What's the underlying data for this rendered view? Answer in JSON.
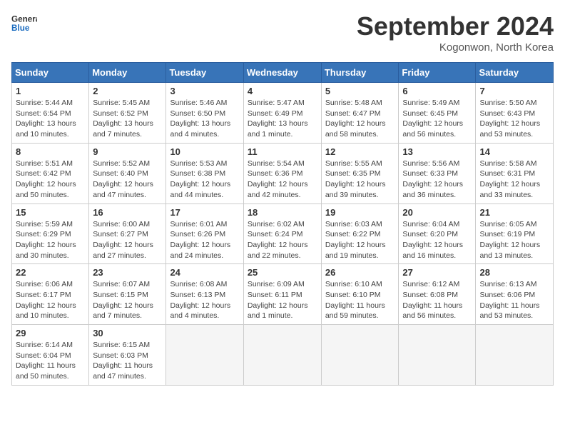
{
  "logo": {
    "line1": "General",
    "line2": "Blue"
  },
  "title": "September 2024",
  "location": "Kogonwon, North Korea",
  "days_of_week": [
    "Sunday",
    "Monday",
    "Tuesday",
    "Wednesday",
    "Thursday",
    "Friday",
    "Saturday"
  ],
  "weeks": [
    [
      {
        "day": 1,
        "info": "Sunrise: 5:44 AM\nSunset: 6:54 PM\nDaylight: 13 hours and 10 minutes."
      },
      {
        "day": 2,
        "info": "Sunrise: 5:45 AM\nSunset: 6:52 PM\nDaylight: 13 hours and 7 minutes."
      },
      {
        "day": 3,
        "info": "Sunrise: 5:46 AM\nSunset: 6:50 PM\nDaylight: 13 hours and 4 minutes."
      },
      {
        "day": 4,
        "info": "Sunrise: 5:47 AM\nSunset: 6:49 PM\nDaylight: 13 hours and 1 minute."
      },
      {
        "day": 5,
        "info": "Sunrise: 5:48 AM\nSunset: 6:47 PM\nDaylight: 12 hours and 58 minutes."
      },
      {
        "day": 6,
        "info": "Sunrise: 5:49 AM\nSunset: 6:45 PM\nDaylight: 12 hours and 56 minutes."
      },
      {
        "day": 7,
        "info": "Sunrise: 5:50 AM\nSunset: 6:43 PM\nDaylight: 12 hours and 53 minutes."
      }
    ],
    [
      {
        "day": 8,
        "info": "Sunrise: 5:51 AM\nSunset: 6:42 PM\nDaylight: 12 hours and 50 minutes."
      },
      {
        "day": 9,
        "info": "Sunrise: 5:52 AM\nSunset: 6:40 PM\nDaylight: 12 hours and 47 minutes."
      },
      {
        "day": 10,
        "info": "Sunrise: 5:53 AM\nSunset: 6:38 PM\nDaylight: 12 hours and 44 minutes."
      },
      {
        "day": 11,
        "info": "Sunrise: 5:54 AM\nSunset: 6:36 PM\nDaylight: 12 hours and 42 minutes."
      },
      {
        "day": 12,
        "info": "Sunrise: 5:55 AM\nSunset: 6:35 PM\nDaylight: 12 hours and 39 minutes."
      },
      {
        "day": 13,
        "info": "Sunrise: 5:56 AM\nSunset: 6:33 PM\nDaylight: 12 hours and 36 minutes."
      },
      {
        "day": 14,
        "info": "Sunrise: 5:58 AM\nSunset: 6:31 PM\nDaylight: 12 hours and 33 minutes."
      }
    ],
    [
      {
        "day": 15,
        "info": "Sunrise: 5:59 AM\nSunset: 6:29 PM\nDaylight: 12 hours and 30 minutes."
      },
      {
        "day": 16,
        "info": "Sunrise: 6:00 AM\nSunset: 6:27 PM\nDaylight: 12 hours and 27 minutes."
      },
      {
        "day": 17,
        "info": "Sunrise: 6:01 AM\nSunset: 6:26 PM\nDaylight: 12 hours and 24 minutes."
      },
      {
        "day": 18,
        "info": "Sunrise: 6:02 AM\nSunset: 6:24 PM\nDaylight: 12 hours and 22 minutes."
      },
      {
        "day": 19,
        "info": "Sunrise: 6:03 AM\nSunset: 6:22 PM\nDaylight: 12 hours and 19 minutes."
      },
      {
        "day": 20,
        "info": "Sunrise: 6:04 AM\nSunset: 6:20 PM\nDaylight: 12 hours and 16 minutes."
      },
      {
        "day": 21,
        "info": "Sunrise: 6:05 AM\nSunset: 6:19 PM\nDaylight: 12 hours and 13 minutes."
      }
    ],
    [
      {
        "day": 22,
        "info": "Sunrise: 6:06 AM\nSunset: 6:17 PM\nDaylight: 12 hours and 10 minutes."
      },
      {
        "day": 23,
        "info": "Sunrise: 6:07 AM\nSunset: 6:15 PM\nDaylight: 12 hours and 7 minutes."
      },
      {
        "day": 24,
        "info": "Sunrise: 6:08 AM\nSunset: 6:13 PM\nDaylight: 12 hours and 4 minutes."
      },
      {
        "day": 25,
        "info": "Sunrise: 6:09 AM\nSunset: 6:11 PM\nDaylight: 12 hours and 1 minute."
      },
      {
        "day": 26,
        "info": "Sunrise: 6:10 AM\nSunset: 6:10 PM\nDaylight: 11 hours and 59 minutes."
      },
      {
        "day": 27,
        "info": "Sunrise: 6:12 AM\nSunset: 6:08 PM\nDaylight: 11 hours and 56 minutes."
      },
      {
        "day": 28,
        "info": "Sunrise: 6:13 AM\nSunset: 6:06 PM\nDaylight: 11 hours and 53 minutes."
      }
    ],
    [
      {
        "day": 29,
        "info": "Sunrise: 6:14 AM\nSunset: 6:04 PM\nDaylight: 11 hours and 50 minutes."
      },
      {
        "day": 30,
        "info": "Sunrise: 6:15 AM\nSunset: 6:03 PM\nDaylight: 11 hours and 47 minutes."
      },
      {
        "day": null,
        "info": ""
      },
      {
        "day": null,
        "info": ""
      },
      {
        "day": null,
        "info": ""
      },
      {
        "day": null,
        "info": ""
      },
      {
        "day": null,
        "info": ""
      }
    ]
  ]
}
